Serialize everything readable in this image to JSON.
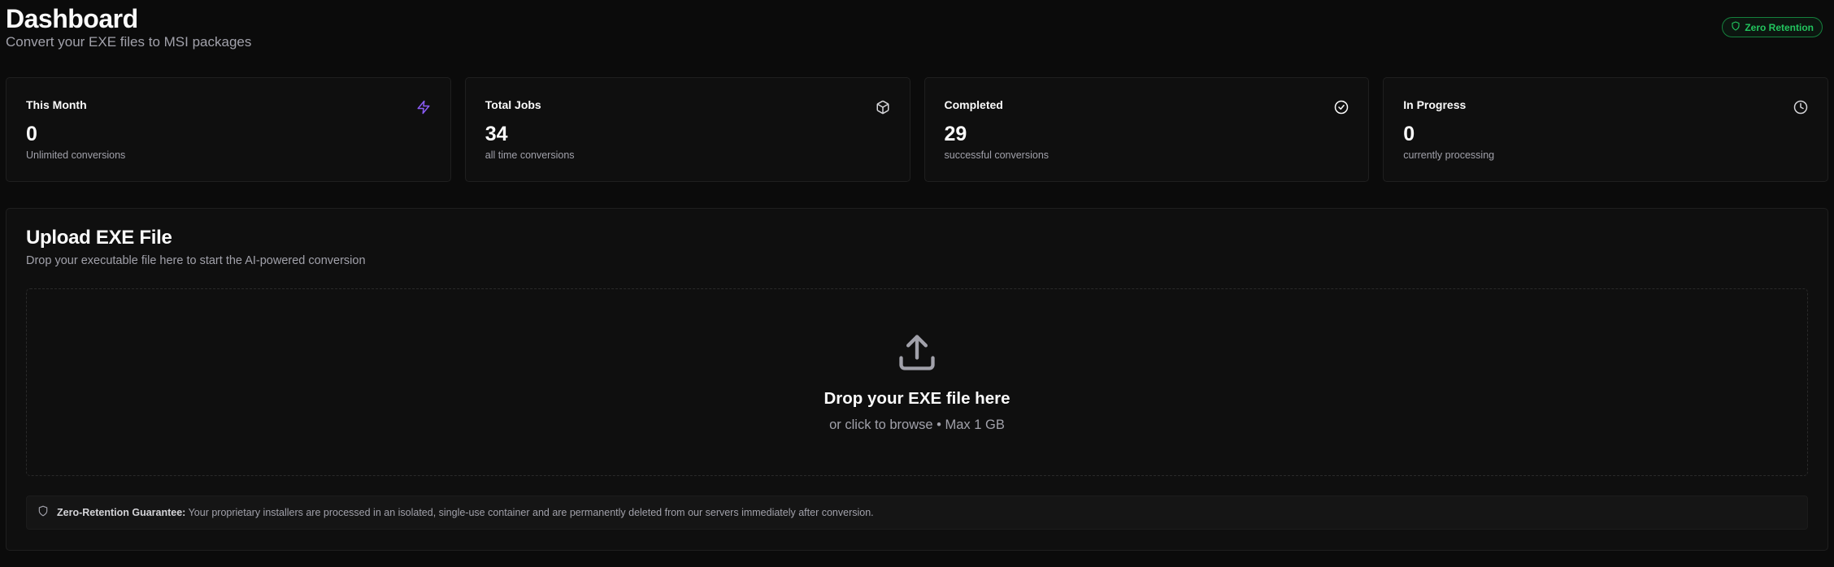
{
  "header": {
    "title": "Dashboard",
    "subtitle": "Convert your EXE files to MSI packages",
    "badge": {
      "label": "Zero Retention",
      "icon": "shield-icon",
      "color": "#22c55e"
    }
  },
  "stats": [
    {
      "label": "This Month",
      "value": "0",
      "sub": "Unlimited conversions",
      "icon": "zap-icon",
      "icon_color": "#8b5cf6"
    },
    {
      "label": "Total Jobs",
      "value": "34",
      "sub": "all time conversions",
      "icon": "package-icon",
      "icon_color": "#d4d4d8"
    },
    {
      "label": "Completed",
      "value": "29",
      "sub": "successful conversions",
      "icon": "check-circle-icon",
      "icon_color": "#fafafa"
    },
    {
      "label": "In Progress",
      "value": "0",
      "sub": "currently processing",
      "icon": "clock-icon",
      "icon_color": "#d4d4d8"
    }
  ],
  "upload": {
    "title": "Upload EXE File",
    "subtitle": "Drop your executable file here to start the AI-powered conversion",
    "drop_title": "Drop your EXE file here",
    "drop_sub": "or click to browse • Max 1 GB",
    "notice_strong": "Zero-Retention Guarantee:",
    "notice_text": " Your proprietary installers are processed in an isolated, single-use container and are permanently deleted from our servers immediately after conversion."
  },
  "colors": {
    "background": "#0b0b0b",
    "card": "#0f0f0f",
    "border": "#1f1f1f",
    "muted": "#a1a1aa",
    "accent_green": "#22c55e",
    "accent_purple": "#8b5cf6"
  }
}
